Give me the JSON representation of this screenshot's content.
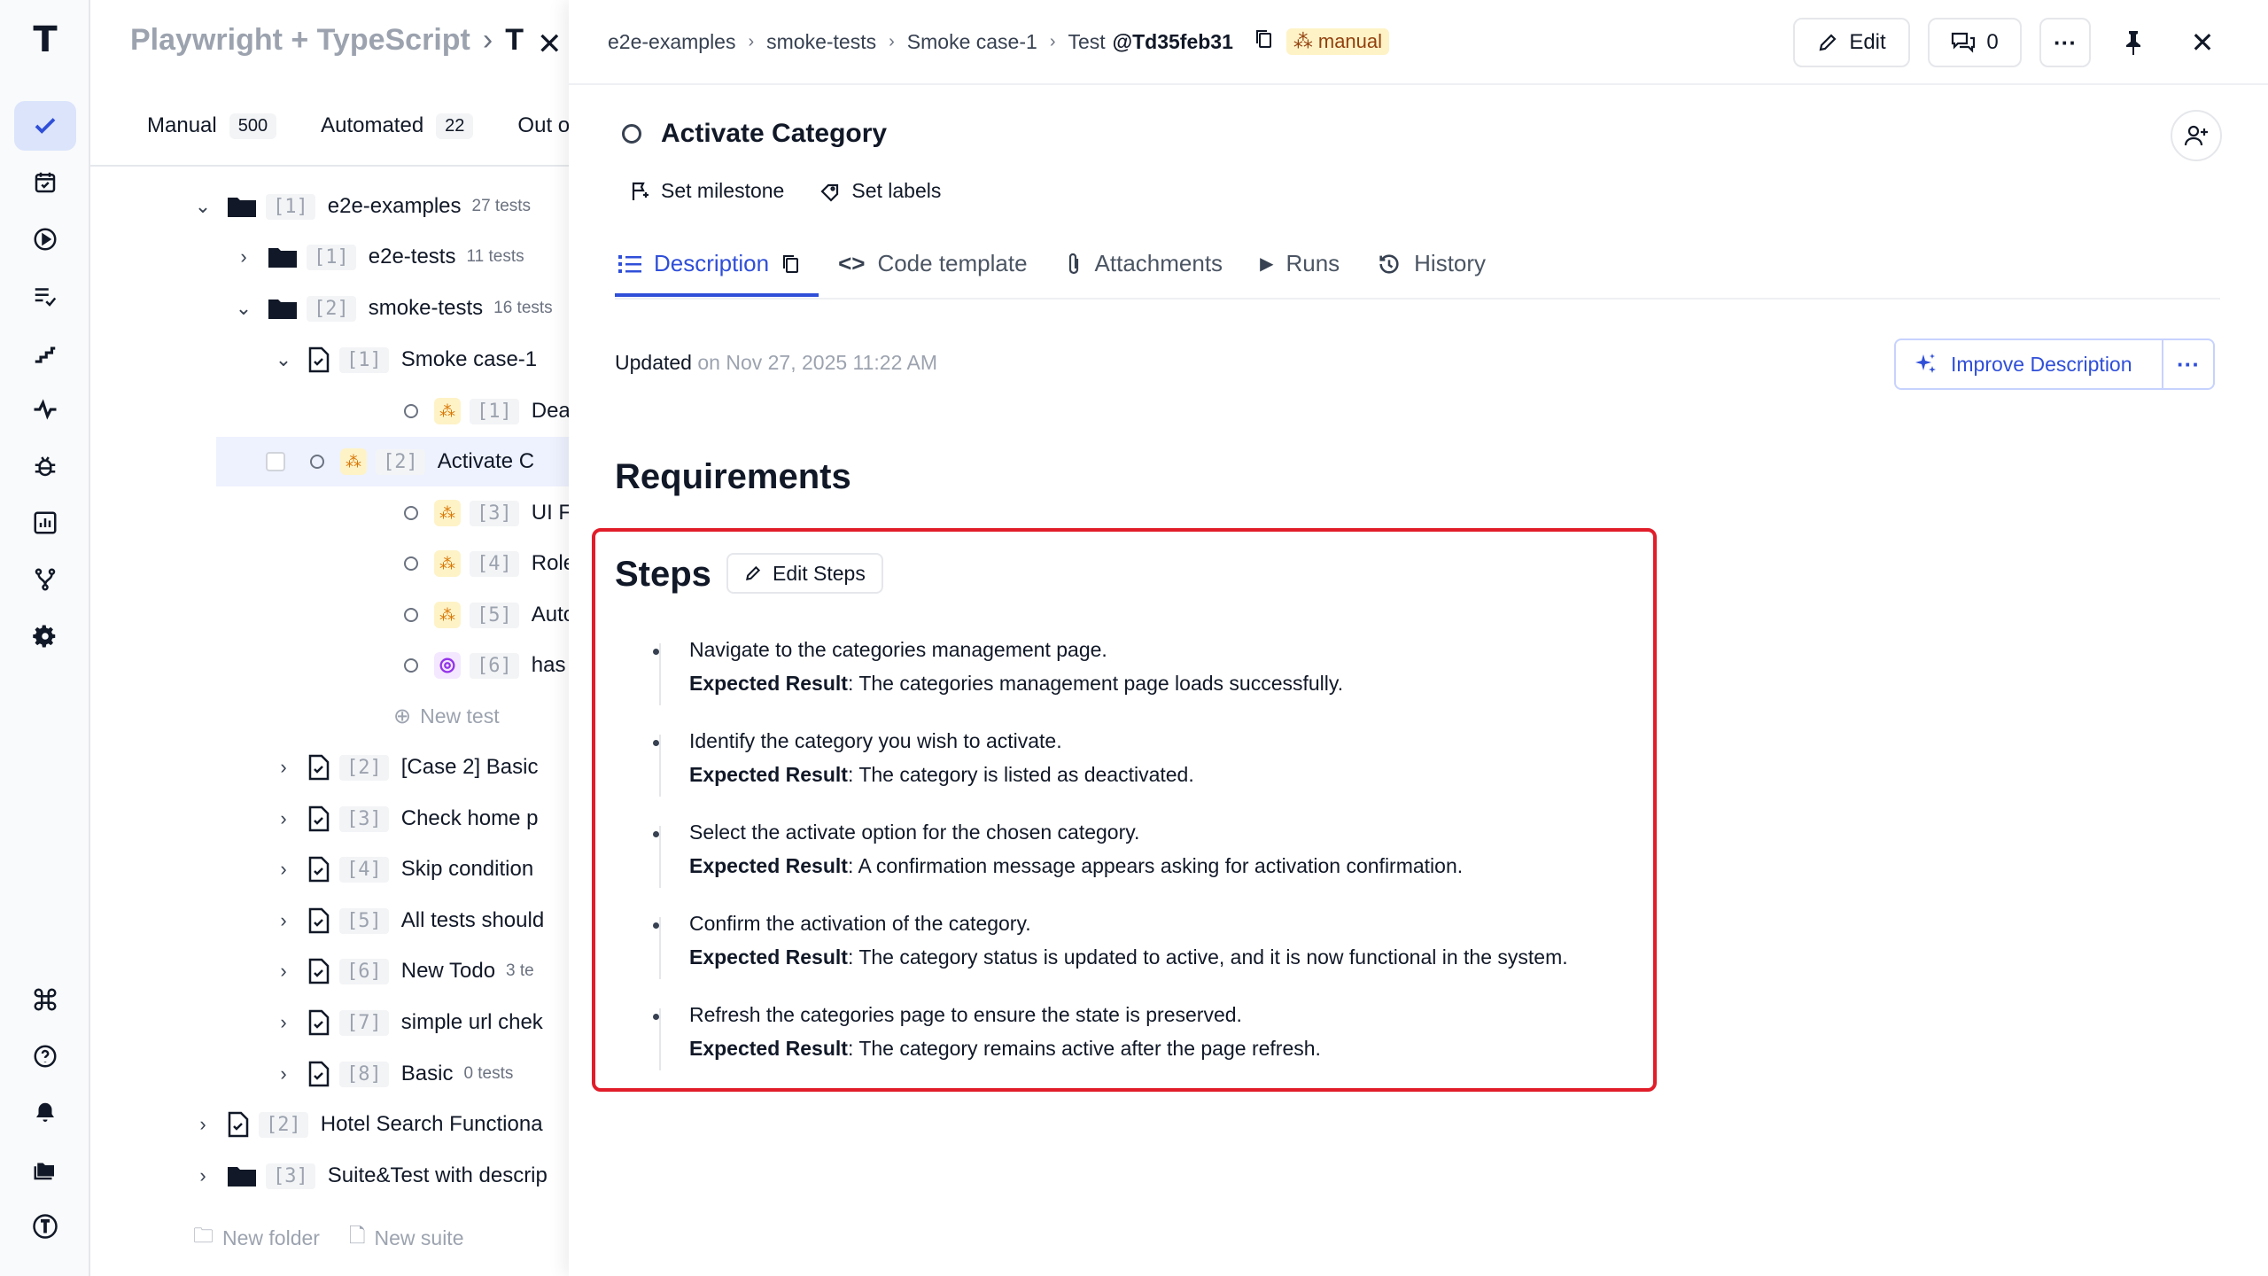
{
  "tree": {
    "title": "Playwright + TypeScript",
    "title_sep": "›",
    "current": "T",
    "tabs": [
      {
        "label": "Manual",
        "count": "500"
      },
      {
        "label": "Automated",
        "count": "22"
      },
      {
        "label": "Out of"
      }
    ],
    "rows": [
      {
        "num": "[1]",
        "label": "e2e-examples",
        "meta": "27 tests"
      },
      {
        "num": "[1]",
        "label": "e2e-tests",
        "meta": "11 tests"
      },
      {
        "num": "[2]",
        "label": "smoke-tests",
        "meta": "16 tests"
      },
      {
        "num": "[1]",
        "label": "Smoke case-1"
      },
      {
        "num": "[1]",
        "label": "Deactivate"
      },
      {
        "num": "[2]",
        "label": "Activate C"
      },
      {
        "num": "[3]",
        "label": "UI Feedba"
      },
      {
        "num": "[4]",
        "label": "Role-Base"
      },
      {
        "num": "[5]",
        "label": "Automated"
      },
      {
        "num": "[6]",
        "label": "has title"
      },
      {
        "num": "[2]",
        "label": "[Case 2] Basic"
      },
      {
        "num": "[3]",
        "label": "Check home p"
      },
      {
        "num": "[4]",
        "label": "Skip condition"
      },
      {
        "num": "[5]",
        "label": "All tests should"
      },
      {
        "num": "[6]",
        "label": "New Todo",
        "meta": "3 te"
      },
      {
        "num": "[7]",
        "label": "simple url chek"
      },
      {
        "num": "[8]",
        "label": "Basic",
        "meta": "0 tests"
      },
      {
        "num": "[2]",
        "label": "Hotel Search Functiona"
      },
      {
        "num": "[3]",
        "label": "Suite&Test with descrip"
      }
    ],
    "new_test": "New test",
    "new_folder": "New folder",
    "new_suite": "New suite"
  },
  "detail": {
    "breadcrumbs": [
      "e2e-examples",
      "smoke-tests",
      "Smoke case-1"
    ],
    "test_prefix": "Test",
    "test_id": "@Td35feb31",
    "badge": "manual",
    "edit_label": "Edit",
    "comments_count": "0",
    "title": "Activate Category",
    "set_milestone": "Set milestone",
    "set_labels": "Set labels",
    "tabs": [
      "Description",
      "Code template",
      "Attachments",
      "Runs",
      "History"
    ],
    "updated_label": "Updated",
    "updated_date": "on Nov 27, 2025 11:22 AM",
    "improve_label": "Improve Description",
    "requirements_heading": "Requirements",
    "steps_heading": "Steps",
    "edit_steps": "Edit Steps",
    "expected_label": "Expected Result",
    "steps": [
      {
        "action": "Navigate to the categories management page.",
        "expected": ": The categories management page loads successfully."
      },
      {
        "action": "Identify the category you wish to activate.",
        "expected": ": The category is listed as deactivated."
      },
      {
        "action": "Select the activate option for the chosen category.",
        "expected": ": A confirmation message appears asking for activation confirmation."
      },
      {
        "action": "Confirm the activation of the category.",
        "expected": ": The category status is updated to active, and it is now functional in the system."
      },
      {
        "action": "Refresh the categories page to ensure the state is preserved.",
        "expected": ": The category remains active after the page refresh."
      }
    ]
  },
  "icons": [
    "check-icon",
    "calendar-check-icon",
    "play-circle-icon",
    "list-check-icon",
    "steps-icon",
    "pulse-icon",
    "bug-icon",
    "bar-chart-icon",
    "branch-icon",
    "gear-icon",
    "command-icon",
    "help-icon",
    "bell-icon",
    "folders-icon",
    "logo-icon"
  ],
  "colors": {
    "accent": "#2f4fd8",
    "highlight_border": "#e11d2a",
    "badge_bg": "#fef3c7"
  }
}
